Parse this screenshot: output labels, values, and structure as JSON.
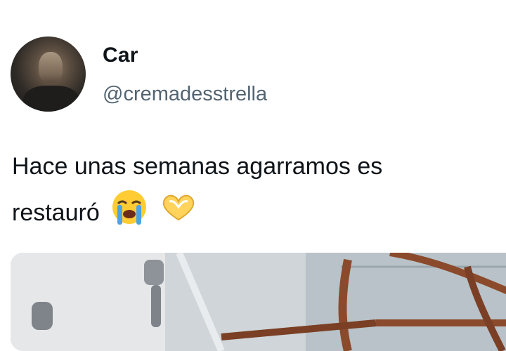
{
  "author": {
    "display_name": "Car",
    "handle": "@cremadesstrella",
    "avatar_icon": "profile-photo"
  },
  "tweet": {
    "line1": "Hace unas semanas agarramos es",
    "line2": "restauró",
    "emojis": [
      "loudly-crying-face-icon",
      "heart-hands-icon"
    ]
  },
  "media": {
    "icon": "photo-of-rusty-metal-chair-frame"
  },
  "colors": {
    "text": "#0f1419",
    "secondary_text": "#536471",
    "background": "#ffffff"
  }
}
